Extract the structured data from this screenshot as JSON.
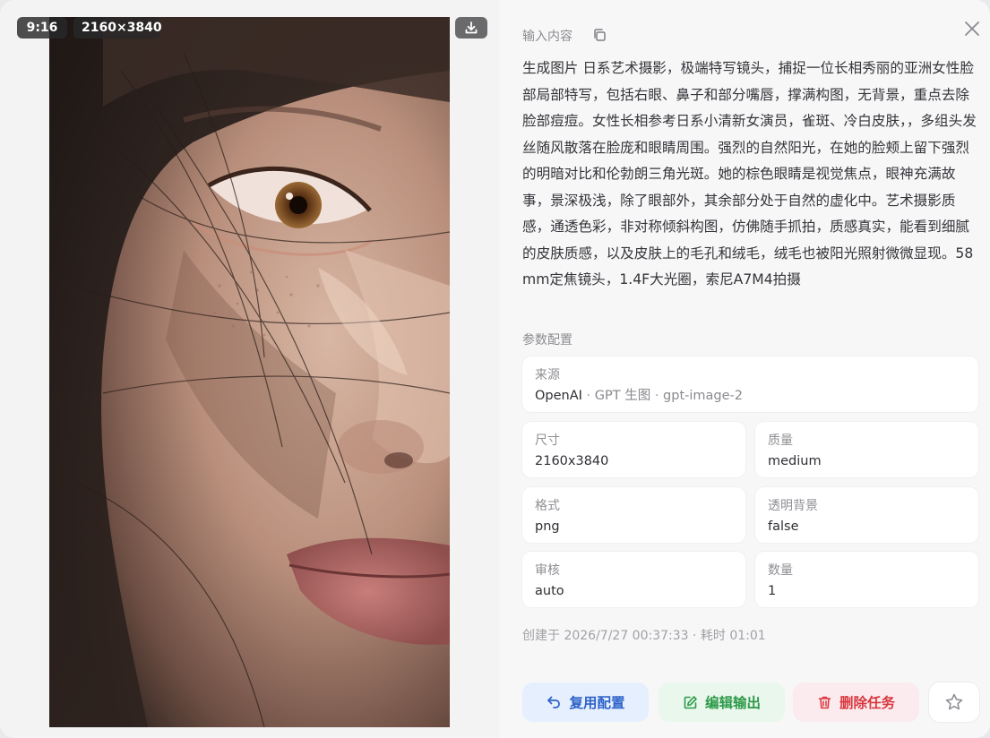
{
  "image_panel": {
    "aspect_ratio": "9:16",
    "resolution": "2160×3840",
    "download_icon": "download-icon"
  },
  "details": {
    "input_section_title": "输入内容",
    "prompt": "生成图片 日系艺术摄影，极端特写镜头，捕捉一位长相秀丽的亚洲女性脸部局部特写，包括右眼、鼻子和部分嘴唇，撑满构图，无背景，重点去除脸部痘痘。女性长相参考日系小清新女演员，雀斑、冷白皮肤，，多组头发丝随风散落在脸庞和眼睛周围。强烈的自然阳光，在她的脸颊上留下强烈的明暗对比和伦勃朗三角光斑。她的棕色眼睛是视觉焦点，眼神充满故事，景深极浅，除了眼部外，其余部分处于自然的虚化中。艺术摄影质感，通透色彩，非对称倾斜构图，仿佛随手抓拍，质感真实，能看到细腻的皮肤质感，以及皮肤上的毛孔和绒毛，绒毛也被阳光照射微微显现。58mm定焦镜头，1.4F大光圈，索尼A7M4拍摄",
    "params_title": "参数配置",
    "source": {
      "label": "来源",
      "provider": "OpenAI",
      "sep": " · ",
      "mode": "GPT 生图",
      "model": "gpt-image-2"
    },
    "params": [
      {
        "label": "尺寸",
        "value": "2160x3840"
      },
      {
        "label": "质量",
        "value": "medium"
      },
      {
        "label": "格式",
        "value": "png"
      },
      {
        "label": "透明背景",
        "value": "false"
      },
      {
        "label": "审核",
        "value": "auto"
      },
      {
        "label": "数量",
        "value": "1"
      }
    ],
    "meta": "创建于 2026/7/27 00:37:33 · 耗时 01:01"
  },
  "actions": {
    "reuse_label": "复用配置",
    "edit_label": "编辑输出",
    "delete_label": "删除任务"
  },
  "colors": {
    "reuse": "#2e63c9",
    "edit": "#2d9a4a",
    "delete": "#d8383f"
  }
}
